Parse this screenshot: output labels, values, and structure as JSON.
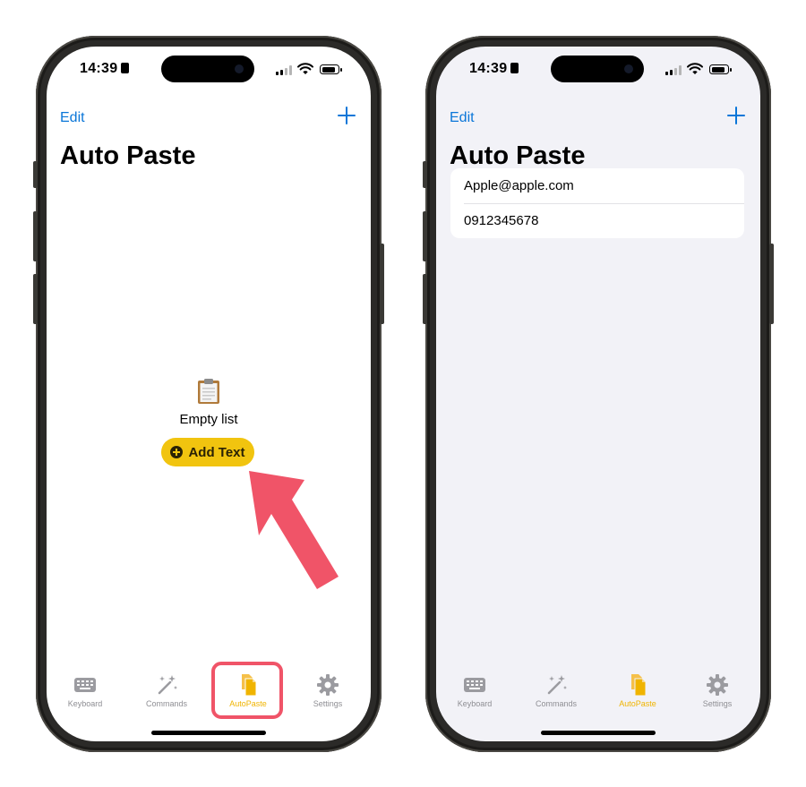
{
  "left_screen": {
    "status": {
      "time": "14:39"
    },
    "nav": {
      "edit": "Edit"
    },
    "title": "Auto Paste",
    "empty_state": {
      "text": "Empty list",
      "button": "Add Text"
    },
    "tabs": [
      {
        "label": "Keyboard",
        "icon": "keyboard-icon"
      },
      {
        "label": "Commands",
        "icon": "sparkles-icon"
      },
      {
        "label": "AutoPaste",
        "icon": "documents-icon"
      },
      {
        "label": "Settings",
        "icon": "gear-icon"
      }
    ]
  },
  "right_screen": {
    "status": {
      "time": "14:39"
    },
    "nav": {
      "edit": "Edit"
    },
    "title": "Auto Paste",
    "items": [
      "Apple@apple.com",
      "0912345678"
    ],
    "tabs": [
      {
        "label": "Keyboard",
        "icon": "keyboard-icon"
      },
      {
        "label": "Commands",
        "icon": "sparkles-icon"
      },
      {
        "label": "AutoPaste",
        "icon": "documents-icon"
      },
      {
        "label": "Settings",
        "icon": "gear-icon"
      }
    ]
  },
  "colors": {
    "accent_blue": "#0a76d8",
    "active_tab": "#f0b400",
    "add_button": "#f1c40f",
    "annotation_red": "#f05468",
    "inactive_tab": "#8e8e93"
  }
}
